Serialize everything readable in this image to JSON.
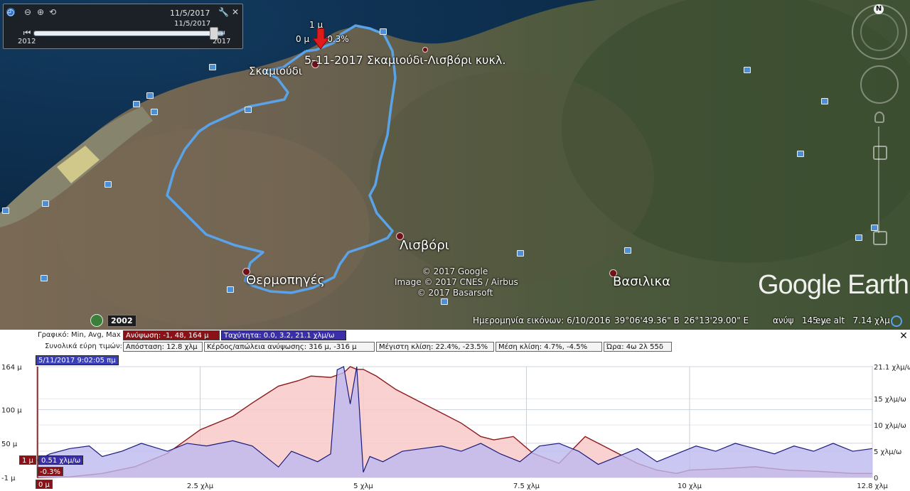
{
  "time_slider": {
    "current_date": "11/5/2017",
    "knob_date": "11/5/2017",
    "start_year": "2012",
    "end_year": "2017",
    "position": 0.95
  },
  "map": {
    "track_title": "5-11-2017 Σκαμιούδι-Λισβόρι κυκλ.",
    "places": {
      "skamioudi": "Σκαμιούδι",
      "lisvori": "Λισβόρι",
      "thermopigés": "Θερμοπηγές",
      "vasilika": "Βασιλικα"
    },
    "marker_labels": {
      "top": "1 μ",
      "left": "0 μ",
      "right": "-0.3%"
    },
    "credits": [
      "© 2017 Google",
      "Image © 2017 CNES / Airbus",
      "© 2017 Basarsoft"
    ],
    "logo": "Google Earth",
    "nav_north": "N",
    "historical_year": "2002",
    "colors": {
      "track": "#5aa3e8",
      "marker": "#e01b1b",
      "place_dot": "#6d1219"
    }
  },
  "status_bar": {
    "imagery_date": "Ημερομηνία εικόνων: 6/10/2016",
    "lat": "39°06'49.36\" Β",
    "lon": "26°13'29.00\" Ε",
    "elev": "ανύψ   145 μ",
    "eye_alt": "eye alt   7.14 χλμ"
  },
  "profile": {
    "row1": {
      "label": "Γραφικό: Min, Avg, Max",
      "elevation": "Ανύψωση: -1, 48, 164 μ",
      "speed": "Ταχύτητα: 0.0, 3.2, 21.1 χλμ/ω"
    },
    "row2": {
      "label": "Συνολικά εύρη τιμών:",
      "distance": "Απόσταση: 12.8 χλμ",
      "gain": "Κέρδος/απώλεια ανύψωσης: 316 μ, -316 μ",
      "max_slope": "Μέγιστη κλίση: 22.4%, -23.5%",
      "avg_slope": "Μέση κλίση: 4.7%, -4.5%",
      "time": "Ώρα: 4ω 2λ 55δ"
    },
    "timestamp": "5/11/2017 9:02:05 πμ",
    "cursor": {
      "elev": "1 μ",
      "speed": "0.51 χλμ/ω",
      "slope": "-0.3%",
      "dist": "0 μ"
    },
    "y_left_ticks": [
      "164 μ",
      "100 μ",
      "50 μ",
      "-1 μ"
    ],
    "y_right_ticks": [
      "21.1 χλμ/ω",
      "15 χλμ/ω",
      "10 χλμ/ω",
      "5 χλμ/ω",
      "0"
    ],
    "x_ticks": [
      "2.5 χλμ",
      "5 χλμ",
      "7.5 χλμ",
      "10 χλμ",
      "12.8 χλμ"
    ]
  },
  "chart_data": {
    "type": "area",
    "xlabel": "",
    "ylabel": "",
    "x_unit": "χλμ",
    "xlim": [
      0,
      12.8
    ],
    "ylim": [
      -1,
      164
    ],
    "y2lim": [
      0,
      21.1
    ],
    "series": [
      {
        "unit": "μ",
        "color": "#8b1a1a",
        "fill": "#f8c9c9",
        "x": [
          0,
          0.5,
          1,
          1.5,
          2,
          2.5,
          3,
          3.3,
          3.7,
          4,
          4.2,
          4.5,
          4.7,
          4.8,
          4.9,
          5.0,
          5.2,
          5.5,
          5.8,
          6.2,
          6.5,
          6.8,
          7.0,
          7.3,
          7.6,
          8.0,
          8.4,
          8.7,
          9.0,
          9.2,
          9.5,
          9.8,
          10,
          10.5,
          11,
          11.5,
          12,
          12.5,
          12.8
        ],
        "y": [
          -1,
          0,
          5,
          15,
          35,
          70,
          90,
          110,
          135,
          143,
          150,
          148,
          155,
          164,
          160,
          160,
          150,
          130,
          115,
          95,
          80,
          60,
          55,
          60,
          35,
          20,
          60,
          45,
          30,
          20,
          10,
          5,
          10,
          12,
          15,
          10,
          8,
          5,
          5
        ]
      },
      {
        "unit": "χλμ/ω",
        "color": "#1a1a7a",
        "fill": "#bdb9ef",
        "x": [
          0,
          0.2,
          0.5,
          0.8,
          1,
          1.3,
          1.6,
          2,
          2.3,
          2.6,
          3,
          3.3,
          3.5,
          3.7,
          3.9,
          4.1,
          4.3,
          4.5,
          4.6,
          4.7,
          4.8,
          4.9,
          5.0,
          5.1,
          5.3,
          5.6,
          5.9,
          6.2,
          6.5,
          6.8,
          7.1,
          7.4,
          7.7,
          8.0,
          8.3,
          8.6,
          8.9,
          9.2,
          9.5,
          9.8,
          10.1,
          10.4,
          10.7,
          11.0,
          11.3,
          11.6,
          11.9,
          12.2,
          12.5,
          12.8
        ],
        "y": [
          3.2,
          4.5,
          5.5,
          6.0,
          4.0,
          5.0,
          6.5,
          5.0,
          6.5,
          6.0,
          7.0,
          6.0,
          4.0,
          2.0,
          5.0,
          4.0,
          3.0,
          4.5,
          20.5,
          21.1,
          14,
          21.1,
          1.0,
          4.0,
          3.0,
          5.0,
          5.5,
          6.0,
          5.0,
          6.5,
          4.5,
          3.0,
          6.0,
          6.5,
          5.0,
          2.5,
          4.0,
          5.5,
          3.0,
          4.5,
          6.0,
          5.0,
          6.5,
          5.5,
          4.5,
          6.0,
          5.0,
          6.5,
          5.0,
          5.5
        ]
      }
    ]
  }
}
